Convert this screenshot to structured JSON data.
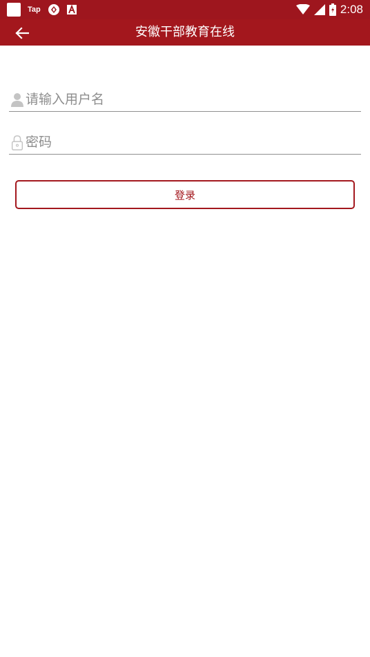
{
  "status_bar": {
    "app_label": "Tap",
    "time": "2:08",
    "icons": [
      "square-icon",
      "tap-icon",
      "sync-icon",
      "a-box-icon",
      "wifi-icon",
      "signal-icon",
      "battery-icon"
    ]
  },
  "app_bar": {
    "title": "安徽干部教育在线",
    "back_icon": "arrow-left-icon"
  },
  "login_form": {
    "username_placeholder": "请输入用户名",
    "password_placeholder": "密码",
    "login_label": "登录"
  },
  "colors": {
    "brand": "#a3171d",
    "status_bar": "#9e161e"
  }
}
